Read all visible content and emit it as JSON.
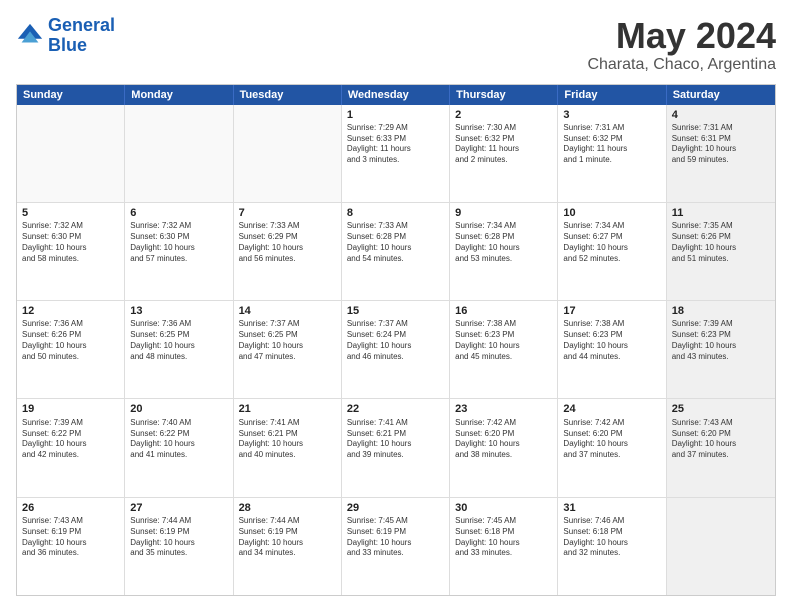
{
  "header": {
    "logo_line1": "General",
    "logo_line2": "Blue",
    "main_title": "May 2024",
    "subtitle": "Charata, Chaco, Argentina"
  },
  "calendar": {
    "weekdays": [
      "Sunday",
      "Monday",
      "Tuesday",
      "Wednesday",
      "Thursday",
      "Friday",
      "Saturday"
    ],
    "rows": [
      [
        {
          "day": "",
          "text": "",
          "empty": true
        },
        {
          "day": "",
          "text": "",
          "empty": true
        },
        {
          "day": "",
          "text": "",
          "empty": true
        },
        {
          "day": "1",
          "text": "Sunrise: 7:29 AM\nSunset: 6:33 PM\nDaylight: 11 hours\nand 3 minutes.",
          "empty": false
        },
        {
          "day": "2",
          "text": "Sunrise: 7:30 AM\nSunset: 6:32 PM\nDaylight: 11 hours\nand 2 minutes.",
          "empty": false
        },
        {
          "day": "3",
          "text": "Sunrise: 7:31 AM\nSunset: 6:32 PM\nDaylight: 11 hours\nand 1 minute.",
          "empty": false
        },
        {
          "day": "4",
          "text": "Sunrise: 7:31 AM\nSunset: 6:31 PM\nDaylight: 10 hours\nand 59 minutes.",
          "empty": false,
          "shaded": true
        }
      ],
      [
        {
          "day": "5",
          "text": "Sunrise: 7:32 AM\nSunset: 6:30 PM\nDaylight: 10 hours\nand 58 minutes.",
          "empty": false
        },
        {
          "day": "6",
          "text": "Sunrise: 7:32 AM\nSunset: 6:30 PM\nDaylight: 10 hours\nand 57 minutes.",
          "empty": false
        },
        {
          "day": "7",
          "text": "Sunrise: 7:33 AM\nSunset: 6:29 PM\nDaylight: 10 hours\nand 56 minutes.",
          "empty": false
        },
        {
          "day": "8",
          "text": "Sunrise: 7:33 AM\nSunset: 6:28 PM\nDaylight: 10 hours\nand 54 minutes.",
          "empty": false
        },
        {
          "day": "9",
          "text": "Sunrise: 7:34 AM\nSunset: 6:28 PM\nDaylight: 10 hours\nand 53 minutes.",
          "empty": false
        },
        {
          "day": "10",
          "text": "Sunrise: 7:34 AM\nSunset: 6:27 PM\nDaylight: 10 hours\nand 52 minutes.",
          "empty": false
        },
        {
          "day": "11",
          "text": "Sunrise: 7:35 AM\nSunset: 6:26 PM\nDaylight: 10 hours\nand 51 minutes.",
          "empty": false,
          "shaded": true
        }
      ],
      [
        {
          "day": "12",
          "text": "Sunrise: 7:36 AM\nSunset: 6:26 PM\nDaylight: 10 hours\nand 50 minutes.",
          "empty": false
        },
        {
          "day": "13",
          "text": "Sunrise: 7:36 AM\nSunset: 6:25 PM\nDaylight: 10 hours\nand 48 minutes.",
          "empty": false
        },
        {
          "day": "14",
          "text": "Sunrise: 7:37 AM\nSunset: 6:25 PM\nDaylight: 10 hours\nand 47 minutes.",
          "empty": false
        },
        {
          "day": "15",
          "text": "Sunrise: 7:37 AM\nSunset: 6:24 PM\nDaylight: 10 hours\nand 46 minutes.",
          "empty": false
        },
        {
          "day": "16",
          "text": "Sunrise: 7:38 AM\nSunset: 6:23 PM\nDaylight: 10 hours\nand 45 minutes.",
          "empty": false
        },
        {
          "day": "17",
          "text": "Sunrise: 7:38 AM\nSunset: 6:23 PM\nDaylight: 10 hours\nand 44 minutes.",
          "empty": false
        },
        {
          "day": "18",
          "text": "Sunrise: 7:39 AM\nSunset: 6:23 PM\nDaylight: 10 hours\nand 43 minutes.",
          "empty": false,
          "shaded": true
        }
      ],
      [
        {
          "day": "19",
          "text": "Sunrise: 7:39 AM\nSunset: 6:22 PM\nDaylight: 10 hours\nand 42 minutes.",
          "empty": false
        },
        {
          "day": "20",
          "text": "Sunrise: 7:40 AM\nSunset: 6:22 PM\nDaylight: 10 hours\nand 41 minutes.",
          "empty": false
        },
        {
          "day": "21",
          "text": "Sunrise: 7:41 AM\nSunset: 6:21 PM\nDaylight: 10 hours\nand 40 minutes.",
          "empty": false
        },
        {
          "day": "22",
          "text": "Sunrise: 7:41 AM\nSunset: 6:21 PM\nDaylight: 10 hours\nand 39 minutes.",
          "empty": false
        },
        {
          "day": "23",
          "text": "Sunrise: 7:42 AM\nSunset: 6:20 PM\nDaylight: 10 hours\nand 38 minutes.",
          "empty": false
        },
        {
          "day": "24",
          "text": "Sunrise: 7:42 AM\nSunset: 6:20 PM\nDaylight: 10 hours\nand 37 minutes.",
          "empty": false
        },
        {
          "day": "25",
          "text": "Sunrise: 7:43 AM\nSunset: 6:20 PM\nDaylight: 10 hours\nand 37 minutes.",
          "empty": false,
          "shaded": true
        }
      ],
      [
        {
          "day": "26",
          "text": "Sunrise: 7:43 AM\nSunset: 6:19 PM\nDaylight: 10 hours\nand 36 minutes.",
          "empty": false
        },
        {
          "day": "27",
          "text": "Sunrise: 7:44 AM\nSunset: 6:19 PM\nDaylight: 10 hours\nand 35 minutes.",
          "empty": false
        },
        {
          "day": "28",
          "text": "Sunrise: 7:44 AM\nSunset: 6:19 PM\nDaylight: 10 hours\nand 34 minutes.",
          "empty": false
        },
        {
          "day": "29",
          "text": "Sunrise: 7:45 AM\nSunset: 6:19 PM\nDaylight: 10 hours\nand 33 minutes.",
          "empty": false
        },
        {
          "day": "30",
          "text": "Sunrise: 7:45 AM\nSunset: 6:18 PM\nDaylight: 10 hours\nand 33 minutes.",
          "empty": false
        },
        {
          "day": "31",
          "text": "Sunrise: 7:46 AM\nSunset: 6:18 PM\nDaylight: 10 hours\nand 32 minutes.",
          "empty": false
        },
        {
          "day": "",
          "text": "",
          "empty": true,
          "shaded": true
        }
      ]
    ]
  }
}
